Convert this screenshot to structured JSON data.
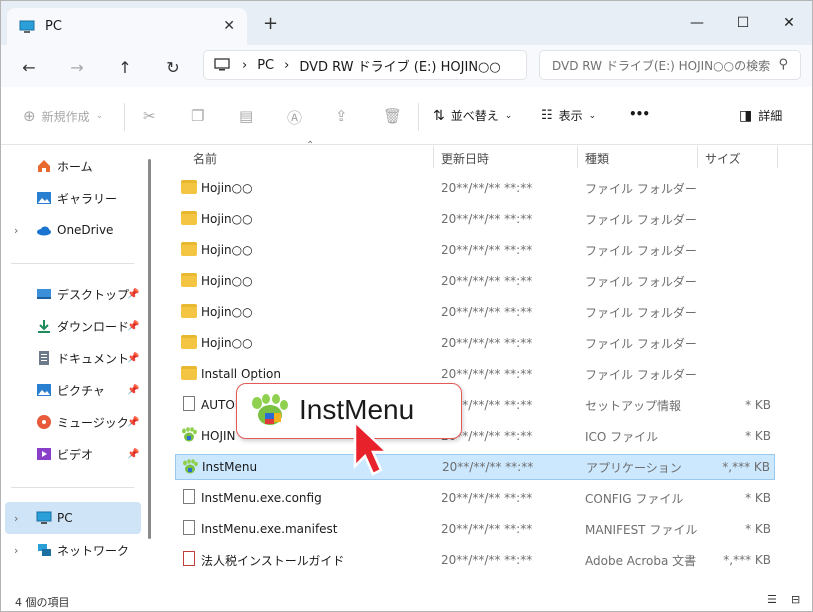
{
  "window": {
    "tab_title": "PC",
    "new_tab": "+",
    "minimize": "—",
    "maximize": "☐",
    "close": "✕"
  },
  "nav": {
    "back": "←",
    "forward": "→",
    "up": "↑",
    "refresh": "↻"
  },
  "address": {
    "segments": [
      "PC",
      "DVD RW ドライブ (E:) HOJIN○○"
    ]
  },
  "search": {
    "placeholder": "DVD RW ドライブ(E:) HOJIN○○の検索"
  },
  "toolbar": {
    "new_label": "新規作成",
    "sort_label": "並べ替え",
    "view_label": "表示",
    "more_label": "•••",
    "details_label": "詳細"
  },
  "sidebar": {
    "items": [
      {
        "label": "ホーム",
        "icon": "home-icon"
      },
      {
        "label": "ギャラリー",
        "icon": "gallery-icon"
      },
      {
        "label": "OneDrive",
        "icon": "onedrive-icon"
      },
      {
        "label": "デスクトップ",
        "icon": "desktop-icon"
      },
      {
        "label": "ダウンロード",
        "icon": "download-icon"
      },
      {
        "label": "ドキュメント",
        "icon": "documents-icon"
      },
      {
        "label": "ピクチャ",
        "icon": "pictures-icon"
      },
      {
        "label": "ミュージック",
        "icon": "music-icon"
      },
      {
        "label": "ビデオ",
        "icon": "video-icon"
      },
      {
        "label": "PC",
        "icon": "pc-icon"
      },
      {
        "label": "ネットワーク",
        "icon": "network-icon"
      }
    ]
  },
  "columns": {
    "name": "名前",
    "date": "更新日時",
    "type": "種類",
    "size": "サイズ"
  },
  "files": [
    {
      "name": "Hojin○○",
      "date": "20**/**/**  **:**",
      "type": "ファイル フォルダー",
      "size": "",
      "icon": "folder-icon"
    },
    {
      "name": "Hojin○○",
      "date": "20**/**/**  **:**",
      "type": "ファイル フォルダー",
      "size": "",
      "icon": "folder-icon"
    },
    {
      "name": "Hojin○○",
      "date": "20**/**/**  **:**",
      "type": "ファイル フォルダー",
      "size": "",
      "icon": "folder-icon"
    },
    {
      "name": "Hojin○○",
      "date": "20**/**/**  **:**",
      "type": "ファイル フォルダー",
      "size": "",
      "icon": "folder-icon"
    },
    {
      "name": "Hojin○○",
      "date": "20**/**/**  **:**",
      "type": "ファイル フォルダー",
      "size": "",
      "icon": "folder-icon"
    },
    {
      "name": "Hojin○○",
      "date": "20**/**/**  **:**",
      "type": "ファイル フォルダー",
      "size": "",
      "icon": "folder-icon"
    },
    {
      "name": "Install Option",
      "date": "20**/**/**  **:**",
      "type": "ファイル フォルダー",
      "size": "",
      "icon": "folder-icon"
    },
    {
      "name": "AUTOR",
      "date": "20**/**/**  **:**",
      "type": "セットアップ情報",
      "size": "* KB",
      "icon": "setup-info-icon"
    },
    {
      "name": "HOJIN",
      "date": "20**/**/**  **:**",
      "type": "ICO ファイル",
      "size": "* KB",
      "icon": "app-icon"
    },
    {
      "name": "InstMenu",
      "date": "20**/**/**  **:**",
      "type": "アプリケーション",
      "size": "*,*** KB",
      "icon": "app-icon"
    },
    {
      "name": "InstMenu.exe.config",
      "date": "20**/**/**  **:**",
      "type": "CONFIG ファイル",
      "size": "* KB",
      "icon": "document-icon"
    },
    {
      "name": "InstMenu.exe.manifest",
      "date": "20**/**/**  **:**",
      "type": "MANIFEST ファイル",
      "size": "* KB",
      "icon": "document-icon"
    },
    {
      "name": "法人税インストールガイド",
      "date": "20**/**/**  **:**",
      "type": "Adobe Acroba 文書",
      "size": "*,*** KB",
      "icon": "pdf-icon"
    }
  ],
  "selected_index": 9,
  "callout": {
    "text": "InstMenu"
  },
  "status": {
    "count": "4 個の項目"
  },
  "colors": {
    "selection": "#cce8ff",
    "selection_border": "#99c9ef",
    "callout_border": "#e45a57",
    "cursor": "#e8222a",
    "folder": "#f4c542"
  }
}
